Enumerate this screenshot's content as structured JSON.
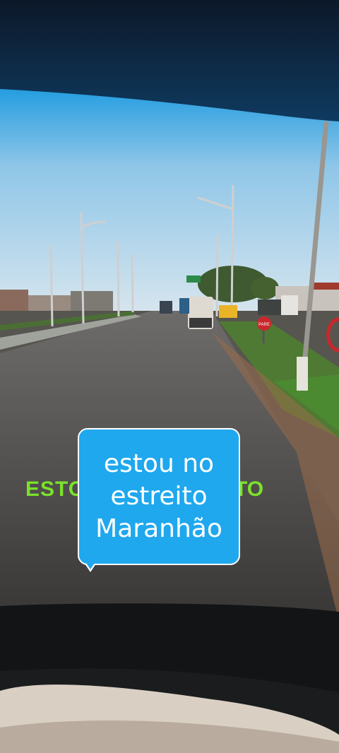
{
  "overlay": {
    "caption_lines": [
      "estou no",
      "estreito",
      "Maranhão"
    ],
    "background_text_left": "ESTO",
    "background_text_right": "TO",
    "bubble_color": "#1fa8ee",
    "background_text_color": "#7be22b"
  },
  "scene": {
    "road_sign_text": "PARE"
  }
}
